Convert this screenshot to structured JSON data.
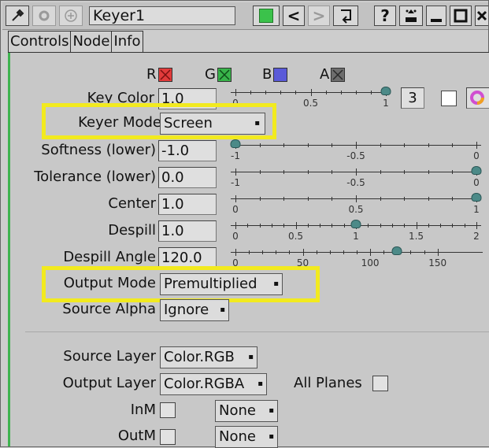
{
  "window": {
    "node_name": "Keyer1",
    "help_label": "?",
    "back_label": "<",
    "forward_label": ">"
  },
  "tabs": [
    "Controls",
    "Node",
    "Info"
  ],
  "channels": {
    "r": "R",
    "g": "G",
    "b": "B",
    "a": "A"
  },
  "colors": {
    "r": "#e23b3b",
    "g": "#38b44a",
    "b": "#5a5ad8",
    "a": "#6d6d6d",
    "highlight": "#f2ea1f",
    "accent": "#3fb34f",
    "knob": "#4c8a88"
  },
  "params": {
    "key_color": {
      "label": "Key Color",
      "value": "1.0",
      "slider_value": 1,
      "count": "3"
    },
    "keyer_mode": {
      "label": "Keyer Mode",
      "value": "Screen"
    },
    "softness": {
      "label": "Softness (lower)",
      "value": "-1.0",
      "slider_value": -1
    },
    "tolerance": {
      "label": "Tolerance (lower)",
      "value": "0.0",
      "slider_value": 0
    },
    "center": {
      "label": "Center",
      "value": "1.0",
      "slider_value": 1
    },
    "despill": {
      "label": "Despill",
      "value": "1.0",
      "slider_value": 1
    },
    "despill_angle": {
      "label": "Despill Angle",
      "value": "120.0",
      "slider_value": 120
    },
    "output_mode": {
      "label": "Output Mode",
      "value": "Premultiplied"
    },
    "source_alpha": {
      "label": "Source Alpha",
      "value": "Ignore"
    },
    "source_layer": {
      "label": "Source Layer",
      "value": "Color.RGB"
    },
    "output_layer": {
      "label": "Output Layer",
      "value": "Color.RGBA"
    },
    "all_planes": {
      "label": "All Planes"
    },
    "inm": {
      "label": "InM",
      "value": "None"
    },
    "outm": {
      "label": "OutM",
      "value": "None"
    }
  },
  "sliders": {
    "key_color": {
      "ticks": [
        "0",
        "0.5",
        "1"
      ]
    },
    "softness": {
      "ticks": [
        "-1",
        "-0.5",
        "0"
      ]
    },
    "tolerance": {
      "ticks": [
        "-1",
        "-0.5",
        "0"
      ]
    },
    "center": {
      "ticks": [
        "0",
        "0.5",
        "1"
      ]
    },
    "despill": {
      "ticks": [
        "0",
        "0.5",
        "1",
        "1.5",
        "2"
      ]
    },
    "despill_angle": {
      "ticks": [
        "0",
        "50",
        "100",
        "150"
      ]
    }
  }
}
